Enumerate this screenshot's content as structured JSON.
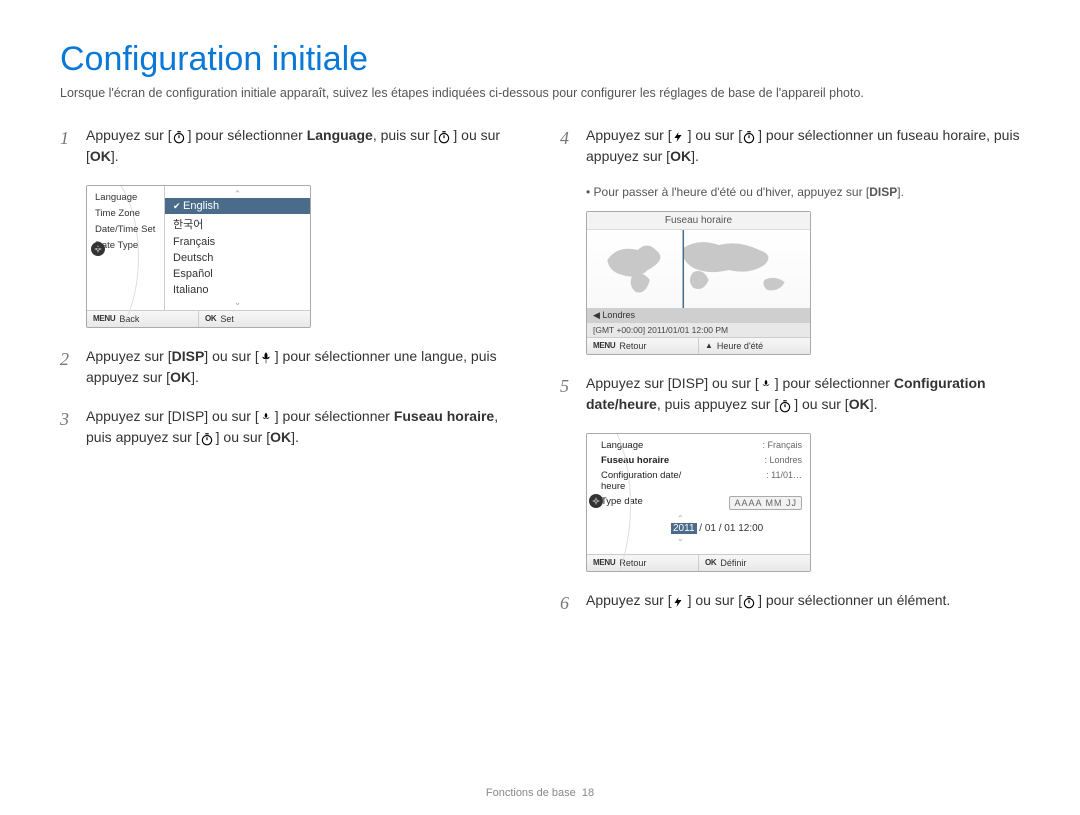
{
  "title": "Configuration initiale",
  "intro": "Lorsque l'écran de configuration initiale apparaît, suivez les étapes indiquées ci-dessous pour configurer les réglages de base de l'appareil photo.",
  "icons": {
    "timer": "timer-icon",
    "ok": "OK",
    "disp": "DISP",
    "flower": "macro-icon",
    "flash": "flash-icon",
    "menu": "MENU"
  },
  "steps": {
    "s1_a": "Appuyez sur [",
    "s1_b": "] pour sélectionner ",
    "s1_bold": "Language",
    "s1_c": ", puis sur [",
    "s1_d": "] ou sur [",
    "s1_e": "].",
    "s2": "Appuyez sur [DISP] ou sur [",
    "s2_b": "] pour sélectionner une langue, puis appuyez sur [",
    "s2_c": "].",
    "s3_a": "Appuyez sur [DISP] ou sur [",
    "s3_b": "] pour sélectionner ",
    "s3_bold": "Fuseau horaire",
    "s3_c": ", puis appuyez sur [",
    "s3_d": "] ou sur [",
    "s3_e": "].",
    "s4_a": "Appuyez sur [",
    "s4_b": "] ou sur [",
    "s4_c": "] pour sélectionner un fuseau horaire, puis appuyez sur [",
    "s4_d": "].",
    "s4_note_a": "Pour passer à l'heure d'été ou d'hiver, appuyez sur [",
    "s4_note_b": "].",
    "s5_a": "Appuyez sur [DISP] ou sur [",
    "s5_b": "] pour sélectionner ",
    "s5_bold": "Configuration date/heure",
    "s5_c": ", puis appuyez sur [",
    "s5_d": "] ou sur [",
    "s5_e": "].",
    "s6_a": "Appuyez sur [",
    "s6_b": "] ou sur [",
    "s6_c": "] pour sélectionner un élément."
  },
  "screen_lang": {
    "menu": [
      "Language",
      "Time Zone",
      "Date/Time Set",
      "Date Type"
    ],
    "options": [
      "English",
      "한국어",
      "Français",
      "Deutsch",
      "Español",
      "Italiano"
    ],
    "footer_left": "Back",
    "footer_right": "Set"
  },
  "screen_tz": {
    "title": "Fuseau horaire",
    "city": "Londres",
    "info": "[GMT +00:00] 2011/01/01 12:00 PM",
    "footer_left": "Retour",
    "footer_right": "Heure d'été"
  },
  "screen_date": {
    "rows": [
      {
        "k": "Language",
        "v": ": Français",
        "bold": false
      },
      {
        "k": "Fuseau horaire",
        "v": ": Londres",
        "bold": true
      },
      {
        "k": "Configuration date/\nheure",
        "v": ": 11/01…",
        "bold": false
      },
      {
        "k": "Type date",
        "v": "",
        "bold": false
      }
    ],
    "format": "AAAA MM JJ",
    "value_pre": "",
    "value_hl": "2011",
    "value_post": " / 01 / 01 12:00",
    "footer_left": "Retour",
    "footer_right": "Définir"
  },
  "footer": {
    "section": "Fonctions de base",
    "page": "18"
  }
}
